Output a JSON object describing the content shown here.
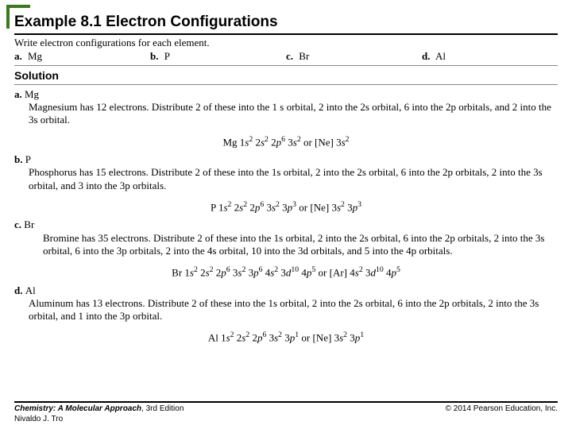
{
  "title": "Example 8.1  Electron Configurations",
  "prompt": "Write electron configurations for each element.",
  "options": [
    {
      "label": "a.",
      "text": "Mg"
    },
    {
      "label": "b.",
      "text": "P"
    },
    {
      "label": "c.",
      "text": "Br"
    },
    {
      "label": "d.",
      "text": "Al"
    }
  ],
  "solution_heading": "Solution",
  "items": [
    {
      "label": "a.",
      "name": "Mg",
      "body": "Magnesium has 12 electrons. Distribute 2 of these into the 1 s orbital, 2 into the 2s orbital, 6 into the 2p orbitals, and 2 into the 3s orbital.",
      "config_html": "Mg 1<i>s</i><sup>2</sup> 2<i>s</i><sup>2</sup> 2<i>p</i><sup>6</sup> 3<i>s</i><sup>2</sup> or [Ne] 3<i>s</i><sup>2</sup>"
    },
    {
      "label": "b.",
      "name": "P",
      "body": "Phosphorus has 15 electrons. Distribute 2 of these into the 1s orbital, 2 into the 2s orbital, 6 into the 2p orbitals, 2 into the 3s orbital, and 3 into the 3p orbitals.",
      "config_html": "P 1<i>s</i><sup>2</sup> 2<i>s</i><sup>2</sup> 2<i>p</i><sup>6</sup> 3<i>s</i><sup>2</sup> 3<i>p</i><sup>3</sup> or [Ne] 3<i>s</i><sup>2</sup> 3<i>p</i><sup>3</sup>"
    },
    {
      "label": "c.",
      "name": "Br",
      "body": "Bromine has 35 electrons. Distribute 2 of these into the 1s orbital, 2 into the 2s orbital, 6 into the 2p orbitals, 2 into the 3s orbital, 6 into the 3p orbitals, 2 into the 4s orbital, 10 into the 3d orbitals, and 5 into the 4p orbitals.",
      "indent_body": true,
      "config_html": "Br 1<i>s</i><sup>2</sup> 2<i>s</i><sup>2</sup> 2<i>p</i><sup>6</sup> 3<i>s</i><sup>2</sup> 3<i>p</i><sup>6</sup> 4<i>s</i><sup>2</sup> 3<i>d</i><sup>10</sup> 4<i>p</i><sup>5</sup> or [Ar] 4<i>s</i><sup>2</sup> 3<i>d</i><sup>10</sup> 4<i>p</i><sup>5</sup>"
    },
    {
      "label": "d.",
      "name": "Al",
      "body": "Aluminum has 13 electrons. Distribute 2 of these into the 1s orbital, 2 into the 2s orbital, 6 into the 2p orbitals, 2 into the 3s orbital, and 1 into the 3p orbital.",
      "config_html": "Al 1<i>s</i><sup>2</sup> 2<i>s</i><sup>2</sup> 2<i>p</i><sup>6</sup> 3<i>s</i><sup>2</sup> 3<i>p</i><sup>1</sup> or [Ne] 3<i>s</i><sup>2</sup> 3<i>p</i><sup>1</sup>"
    }
  ],
  "footer": {
    "book_title": "Chemistry: A Molecular Approach",
    "edition": ", 3rd Edition",
    "author": "Nivaldo J. Tro",
    "copyright": "© 2014 Pearson Education, Inc."
  }
}
